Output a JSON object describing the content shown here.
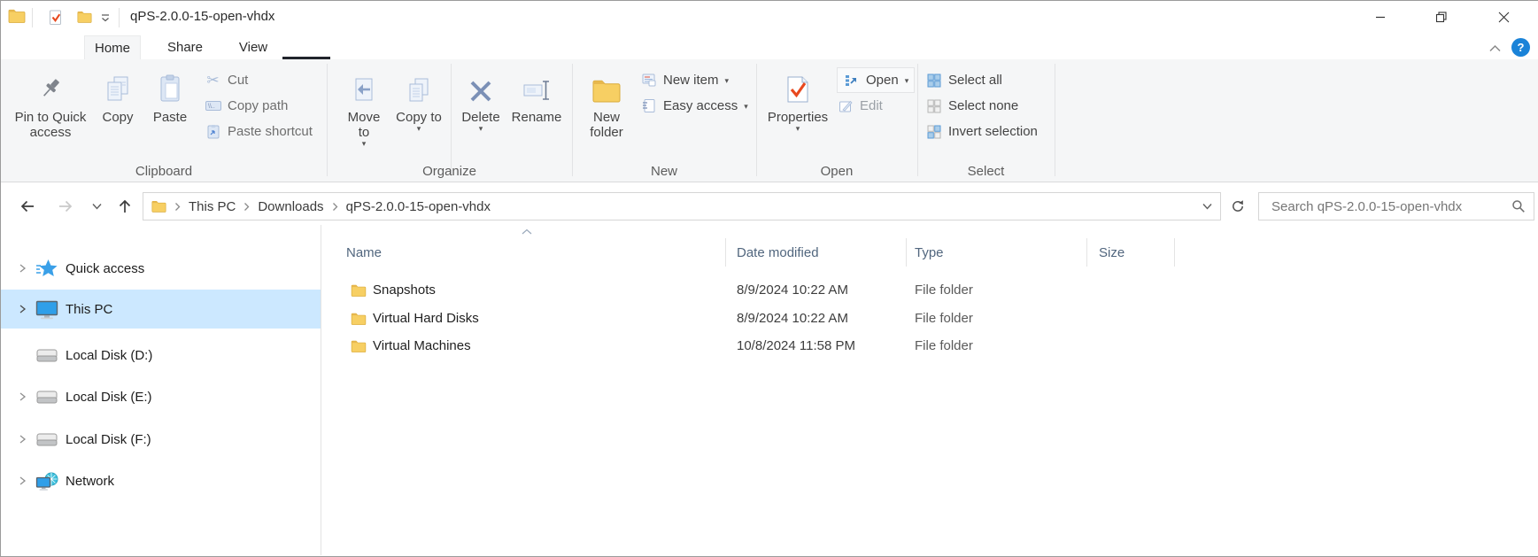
{
  "window": {
    "title": "qPS-2.0.0-15-open-vhdx"
  },
  "tabs": {
    "items": [
      {
        "label": "Home",
        "active": true
      },
      {
        "label": "Share",
        "active": false
      },
      {
        "label": "View",
        "active": false
      }
    ]
  },
  "ribbon": {
    "clipboard": {
      "group_label": "Clipboard",
      "pin_label": "Pin to Quick access",
      "copy_label": "Copy",
      "paste_label": "Paste",
      "cut_label": "Cut",
      "copy_path_label": "Copy path",
      "paste_shortcut_label": "Paste shortcut"
    },
    "organize": {
      "group_label": "Organize",
      "move_to_label": "Move to",
      "copy_to_label": "Copy to",
      "delete_label": "Delete",
      "rename_label": "Rename"
    },
    "new": {
      "group_label": "New",
      "new_folder_label": "New folder",
      "new_item_label": "New item",
      "easy_access_label": "Easy access"
    },
    "open": {
      "group_label": "Open",
      "properties_label": "Properties",
      "open_label": "Open",
      "edit_label": "Edit"
    },
    "select": {
      "group_label": "Select",
      "select_all_label": "Select all",
      "select_none_label": "Select none",
      "invert_label": "Invert selection"
    }
  },
  "navbar": {
    "breadcrumb": [
      "This PC",
      "Downloads",
      "qPS-2.0.0-15-open-vhdx"
    ],
    "search_placeholder": "Search qPS-2.0.0-15-open-vhdx"
  },
  "sidebar": {
    "items": [
      {
        "label": "Quick access",
        "selected": false
      },
      {
        "label": "This PC",
        "selected": true
      },
      {
        "label": "Local Disk (D:)",
        "selected": false
      },
      {
        "label": "Local Disk (E:)",
        "selected": false
      },
      {
        "label": "Local Disk (F:)",
        "selected": false
      },
      {
        "label": "Network",
        "selected": false
      }
    ]
  },
  "filelist": {
    "columns": [
      {
        "label": "Name",
        "sort": "asc"
      },
      {
        "label": "Date modified",
        "sort": ""
      },
      {
        "label": "Type",
        "sort": ""
      },
      {
        "label": "Size",
        "sort": ""
      }
    ],
    "rows": [
      {
        "name": "Snapshots",
        "date_modified": "8/9/2024 10:22 AM",
        "type": "File folder",
        "size": ""
      },
      {
        "name": "Virtual Hard Disks",
        "date_modified": "8/9/2024 10:22 AM",
        "type": "File folder",
        "size": ""
      },
      {
        "name": "Virtual Machines",
        "date_modified": "10/8/2024 11:58 PM",
        "type": "File folder",
        "size": ""
      }
    ]
  },
  "colors": {
    "selection": "#cce8ff",
    "folder_yellow": "#f7cf63",
    "help_blue": "#1a83d8",
    "check_orange": "#e8491f",
    "pale_icon_blue": "#a9bcd9"
  }
}
